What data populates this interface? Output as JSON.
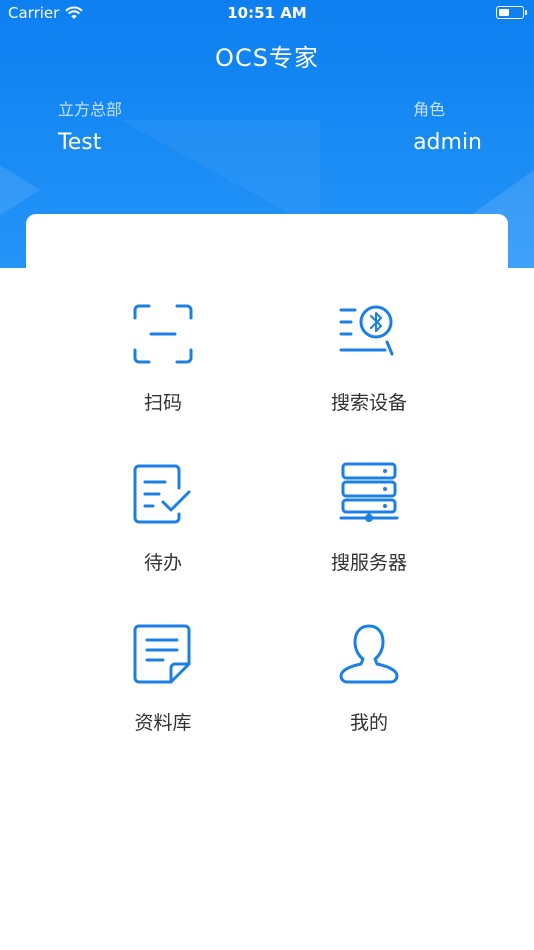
{
  "status_bar": {
    "carrier": "Carrier",
    "time": "10:51 AM",
    "battery_level": 0.45,
    "icons": [
      "wifi-icon",
      "battery-icon"
    ]
  },
  "header": {
    "title": "OCS专家",
    "org_label": "立方总部",
    "org_value": "Test",
    "role_label": "角色",
    "role_value": "admin"
  },
  "menu": {
    "items": [
      {
        "label": "扫码",
        "icon": "scan-icon"
      },
      {
        "label": "搜索设备",
        "icon": "bluetooth-search-icon"
      },
      {
        "label": "待办",
        "icon": "todo-icon"
      },
      {
        "label": "搜服务器",
        "icon": "server-icon"
      },
      {
        "label": "资料库",
        "icon": "document-icon"
      },
      {
        "label": "我的",
        "icon": "user-icon"
      }
    ]
  },
  "colors": {
    "primary": "#1a8cf5",
    "icon": "#1b7fe6",
    "label": "#333333"
  }
}
